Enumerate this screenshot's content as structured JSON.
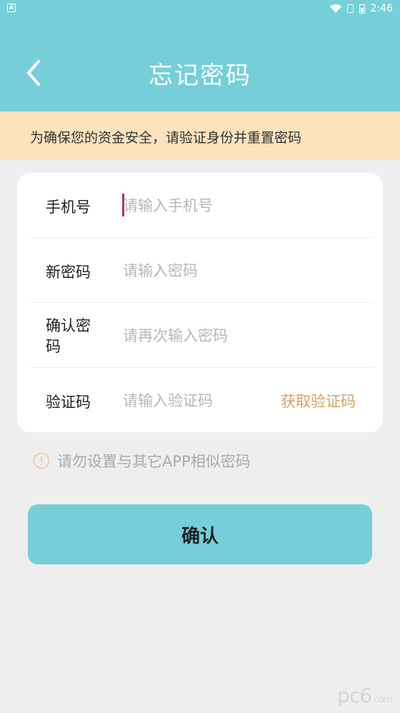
{
  "status_bar": {
    "left_badge": "A",
    "time": "2:46"
  },
  "header": {
    "title": "忘记密码",
    "background": "#76cfd8"
  },
  "notice": {
    "text": "为确保您的资金安全，请验证身份并重置密码",
    "background": "#fde2bd"
  },
  "form": {
    "phone": {
      "label": "手机号",
      "placeholder": "请输入手机号"
    },
    "new_password": {
      "label": "新密码",
      "placeholder": "请输入密码"
    },
    "confirm_password": {
      "label_line1": "确认密",
      "label_line2": "码",
      "placeholder": "请再次输入密码"
    },
    "code": {
      "label": "验证码",
      "placeholder": "请输入验证码",
      "get_code_label": "获取验证码"
    }
  },
  "tip": {
    "text": "请勿设置与其它APP相似密码"
  },
  "confirm": {
    "label": "确认"
  },
  "watermark": {
    "brand": "pc6",
    "suffix": ".com"
  },
  "colors": {
    "accent": "#76cfd8",
    "link": "#d8a266",
    "caret": "#b5306e",
    "tip_icon": "#f4c9a0"
  }
}
